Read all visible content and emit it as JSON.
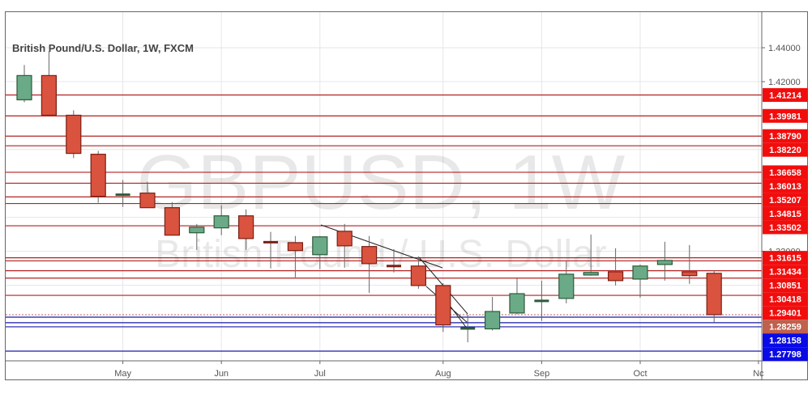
{
  "chart_data": {
    "type": "candlestick",
    "title": "British Pound/U.S. Dollar, 1W, FXCM",
    "watermark": {
      "symbol": "GBPUSD, 1W",
      "name": "British Pound / U.S. Dollar"
    },
    "ylim": [
      1.2755,
      1.446
    ],
    "y_ticks": [
      {
        "value": 1.44,
        "label": "1.44000"
      },
      {
        "value": 1.42,
        "label": "1.42000"
      },
      {
        "value": 1.32,
        "label": "1.32000"
      }
    ],
    "x_ticks": [
      {
        "index": 4,
        "label": "May"
      },
      {
        "index": 8,
        "label": "Jun"
      },
      {
        "index": 12,
        "label": "Jul"
      },
      {
        "index": 17,
        "label": "Aug"
      },
      {
        "index": 21,
        "label": "Sep"
      },
      {
        "index": 25,
        "label": "Oct"
      },
      {
        "index": 29.8,
        "label": "Nc"
      }
    ],
    "candles": [
      {
        "o": 1.4093,
        "h": 1.4298,
        "l": 1.4078,
        "c": 1.4236
      },
      {
        "o": 1.4236,
        "h": 1.438,
        "l": 1.4002,
        "c": 1.4002
      },
      {
        "o": 1.4002,
        "h": 1.4031,
        "l": 1.3749,
        "c": 1.3777
      },
      {
        "o": 1.3772,
        "h": 1.3792,
        "l": 1.3486,
        "c": 1.3524
      },
      {
        "o": 1.3533,
        "h": 1.362,
        "l": 1.3462,
        "c": 1.3534
      },
      {
        "o": 1.3543,
        "h": 1.361,
        "l": 1.3457,
        "c": 1.3457
      },
      {
        "o": 1.3457,
        "h": 1.349,
        "l": 1.3295,
        "c": 1.3295
      },
      {
        "o": 1.3309,
        "h": 1.3361,
        "l": 1.3208,
        "c": 1.3342
      },
      {
        "o": 1.3338,
        "h": 1.3471,
        "l": 1.3295,
        "c": 1.3409
      },
      {
        "o": 1.3409,
        "h": 1.3447,
        "l": 1.3208,
        "c": 1.3275
      },
      {
        "o": 1.3256,
        "h": 1.3314,
        "l": 1.3099,
        "c": 1.3251
      },
      {
        "o": 1.3251,
        "h": 1.329,
        "l": 1.3046,
        "c": 1.3204
      },
      {
        "o": 1.318,
        "h": 1.329,
        "l": 1.3094,
        "c": 1.3285
      },
      {
        "o": 1.3318,
        "h": 1.3361,
        "l": 1.3103,
        "c": 1.3232
      },
      {
        "o": 1.3228,
        "h": 1.329,
        "l": 1.2955,
        "c": 1.3127
      },
      {
        "o": 1.3118,
        "h": 1.3213,
        "l": 1.3075,
        "c": 1.3108
      },
      {
        "o": 1.3113,
        "h": 1.317,
        "l": 1.2979,
        "c": 1.2998
      },
      {
        "o": 1.2998,
        "h": 1.3012,
        "l": 1.2804,
        "c": 1.2813
      },
      {
        "o": 1.2808,
        "h": 1.2826,
        "l": 1.2791,
        "c": 1.2809
      },
      {
        "o": 1.2808,
        "h": 1.2931,
        "l": 1.2806,
        "c": 1.2845
      },
      {
        "o": 1.2836,
        "h": 1.3041,
        "l": 1.2829,
        "c": 1.295
      },
      {
        "o": 1.2907,
        "h": 1.3027,
        "l": 1.2818,
        "c": 1.2908
      },
      {
        "o": 1.2922,
        "h": 1.3142,
        "l": 1.2893,
        "c": 1.3065
      },
      {
        "o": 1.306,
        "h": 1.3299,
        "l": 1.3056,
        "c": 1.3075
      },
      {
        "o": 1.3079,
        "h": 1.3218,
        "l": 1.2998,
        "c": 1.3027
      },
      {
        "o": 1.3036,
        "h": 1.3122,
        "l": 1.2926,
        "c": 1.3113
      },
      {
        "o": 1.3122,
        "h": 1.3256,
        "l": 1.3027,
        "c": 1.3146
      },
      {
        "o": 1.3079,
        "h": 1.3237,
        "l": 1.3008,
        "c": 1.3056
      },
      {
        "o": 1.307,
        "h": 1.3089,
        "l": 1.2816,
        "c": 1.2826
      }
    ],
    "levels": [
      {
        "value": 1.41214,
        "label": "1.41214",
        "kind": "resistance"
      },
      {
        "value": 1.39981,
        "label": "1.39981",
        "kind": "resistance"
      },
      {
        "value": 1.3879,
        "label": "1.38790",
        "kind": "resistance"
      },
      {
        "value": 1.3822,
        "label": "1.38220",
        "kind": "resistance"
      },
      {
        "value": 1.36658,
        "label": "1.36658",
        "kind": "resistance"
      },
      {
        "value": 1.36013,
        "label": "1.36013",
        "kind": "resistance"
      },
      {
        "value": 1.35207,
        "label": "1.35207",
        "kind": "resistance"
      },
      {
        "value": 1.34815,
        "label": "1.34815",
        "kind": "resistance"
      },
      {
        "value": 1.33502,
        "label": "1.33502",
        "kind": "resistance"
      },
      {
        "value": 1.31615,
        "label": "1.31615",
        "kind": "resistance"
      },
      {
        "value": 1.31434,
        "label": "1.31434",
        "kind": "resistance"
      },
      {
        "value": 1.30851,
        "label": "1.30851",
        "kind": "resistance"
      },
      {
        "value": 1.30418,
        "label": "1.30418",
        "kind": "resistance"
      },
      {
        "value": 1.29401,
        "label": "1.29401",
        "kind": "resistance"
      },
      {
        "value": 1.28259,
        "label": "1.28259",
        "kind": "current"
      },
      {
        "value": 1.28158,
        "label": "1.28158",
        "kind": "support"
      },
      {
        "value": 1.27798,
        "label": "1.27798",
        "kind": "support"
      }
    ],
    "extra_support_lines": [
      1.28228,
      1.28106
    ],
    "colors": {
      "up": "#6aaa87",
      "up_border": "#2d5a3c",
      "down": "#d9533f",
      "down_border": "#7a1f14",
      "resistance": "#b22222",
      "support": "#1a1aa6",
      "resistance_label": "#f20d0d",
      "support_label": "#0a0ae6",
      "current_label": "#c0604d"
    }
  }
}
